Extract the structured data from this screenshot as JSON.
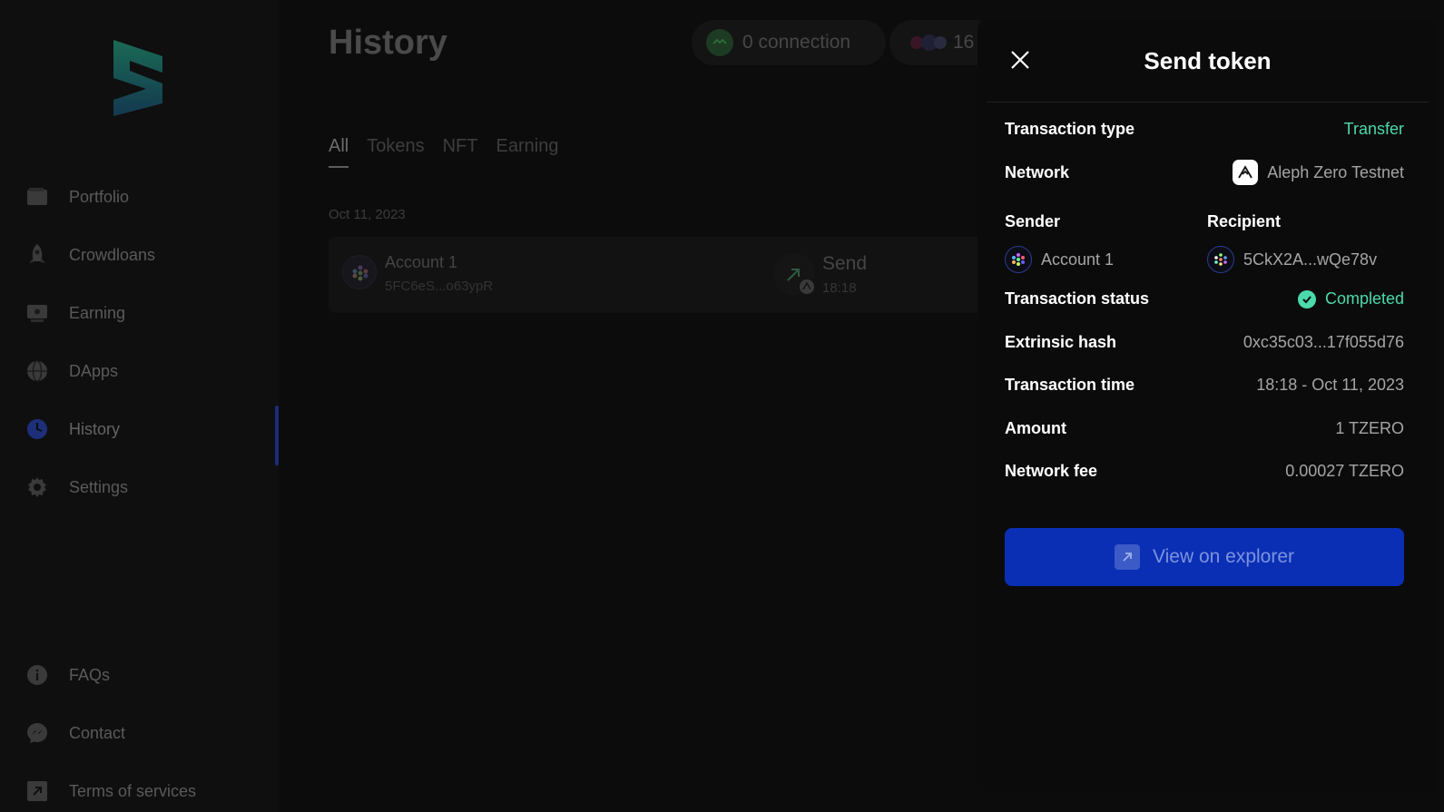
{
  "sidebar": {
    "items": [
      {
        "label": "Portfolio",
        "icon": "wallet-icon"
      },
      {
        "label": "Crowdloans",
        "icon": "rocket-icon"
      },
      {
        "label": "Earning",
        "icon": "earning-icon"
      },
      {
        "label": "DApps",
        "icon": "globe-icon"
      },
      {
        "label": "History",
        "icon": "clock-icon"
      },
      {
        "label": "Settings",
        "icon": "gear-icon"
      }
    ],
    "bottom_items": [
      {
        "label": "FAQs",
        "icon": "info-icon"
      },
      {
        "label": "Contact",
        "icon": "messenger-icon"
      },
      {
        "label": "Terms of services",
        "icon": "external-link-icon"
      }
    ],
    "active": "History"
  },
  "header": {
    "title": "History",
    "connection_label": "0 connection",
    "network_count": "16"
  },
  "tabs": [
    "All",
    "Tokens",
    "NFT",
    "Earning"
  ],
  "active_tab": "All",
  "history": {
    "date": "Oct 11, 2023",
    "row": {
      "account_name": "Account 1",
      "account_address": "5FC6eS...o63ypR",
      "type": "Send",
      "time": "18:18"
    }
  },
  "modal": {
    "title": "Send token",
    "transaction_type_label": "Transaction type",
    "transaction_type_value": "Transfer",
    "network_label": "Network",
    "network_value": "Aleph Zero Testnet",
    "sender_label": "Sender",
    "sender_value": "Account 1",
    "recipient_label": "Recipient",
    "recipient_value": "5CkX2A...wQe78v",
    "status_label": "Transaction status",
    "status_value": "Completed",
    "hash_label": "Extrinsic hash",
    "hash_value": "0xc35c03...17f055d76",
    "time_label": "Transaction time",
    "time_value": "18:18 - Oct 11, 2023",
    "amount_label": "Amount",
    "amount_value": "1 TZERO",
    "fee_label": "Network fee",
    "fee_value": "0.00027 TZERO",
    "explorer_button": "View on explorer"
  },
  "colors": {
    "accent": "#0a2fb5",
    "success": "#4cd9ac",
    "background": "#0c0c0c"
  }
}
